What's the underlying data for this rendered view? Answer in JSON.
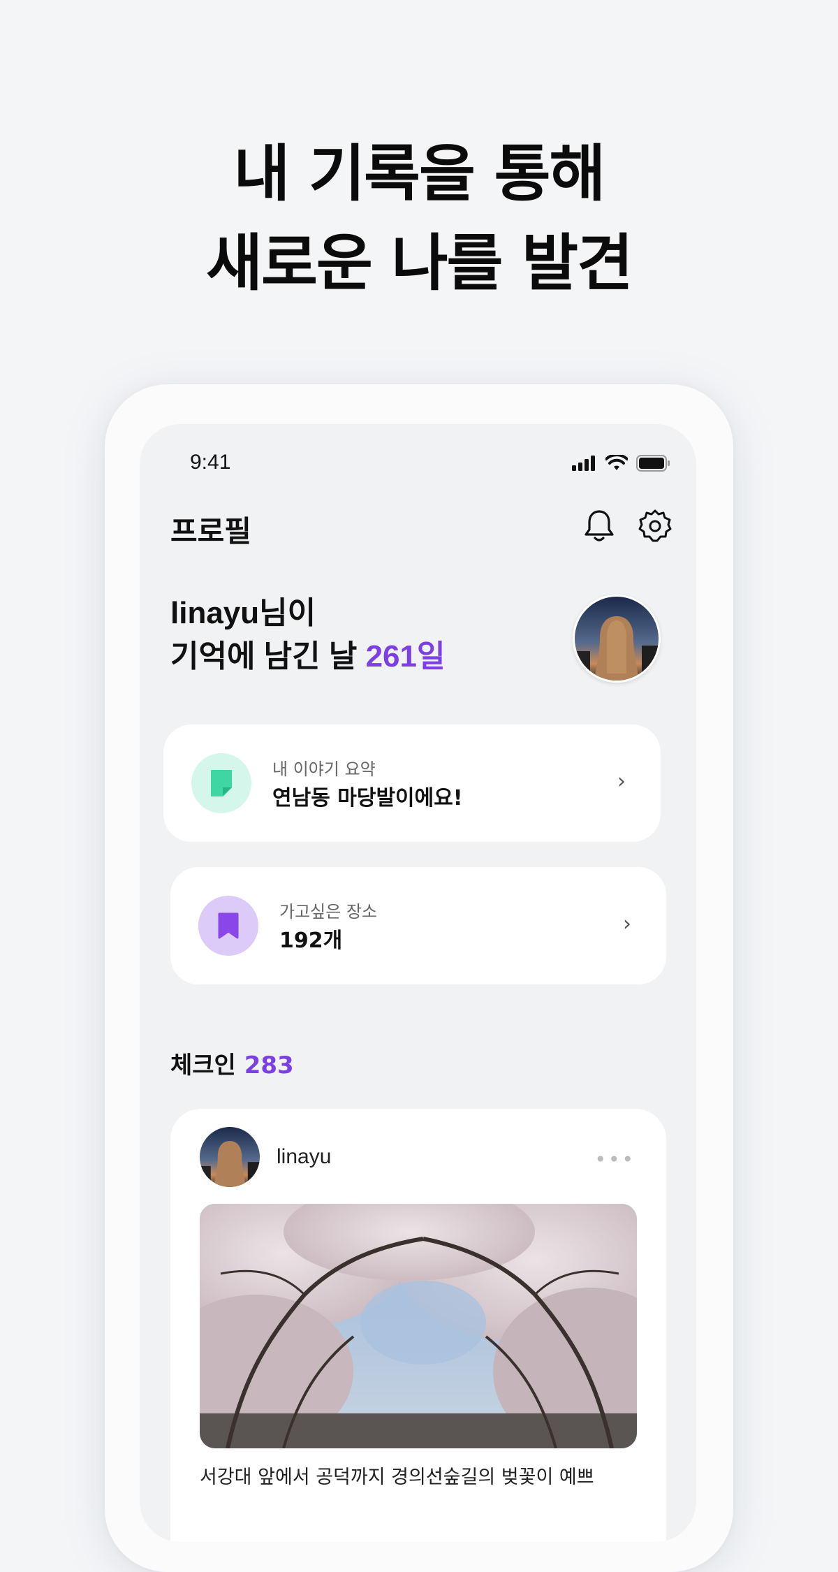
{
  "headline": {
    "line1": "내 기록을 통해",
    "line2": "새로운 나를 발견"
  },
  "status_bar": {
    "time": "9:41",
    "icons": [
      "cellular-signal-icon",
      "wifi-icon",
      "battery-icon"
    ]
  },
  "header": {
    "title": "프로필",
    "icons": [
      "bell-icon",
      "gear-icon"
    ]
  },
  "profile": {
    "greeting_line1": "linayu님이",
    "greeting_line2_prefix": "기억에 남긴 날 ",
    "days": "261일"
  },
  "cards": [
    {
      "label": "내 이야기 요약",
      "value": "연남동 마당발이에요!",
      "icon": "note-icon",
      "chevron": "›",
      "color": "#3fd6a3"
    },
    {
      "label": "가고싶은 장소",
      "value": "192개",
      "icon": "bookmark-icon",
      "chevron": "›",
      "color": "#8a46e8"
    }
  ],
  "checkin": {
    "label": "체크인 ",
    "count": "283"
  },
  "post": {
    "username": "linayu",
    "more": "•••",
    "caption": "서강대 앞에서 공덕까지 경의선숲길의 벚꽃이 예쁘"
  },
  "colors": {
    "accent": "#7b3fe4",
    "background": "#f3f5f7",
    "screen": "#f1f2f4"
  }
}
